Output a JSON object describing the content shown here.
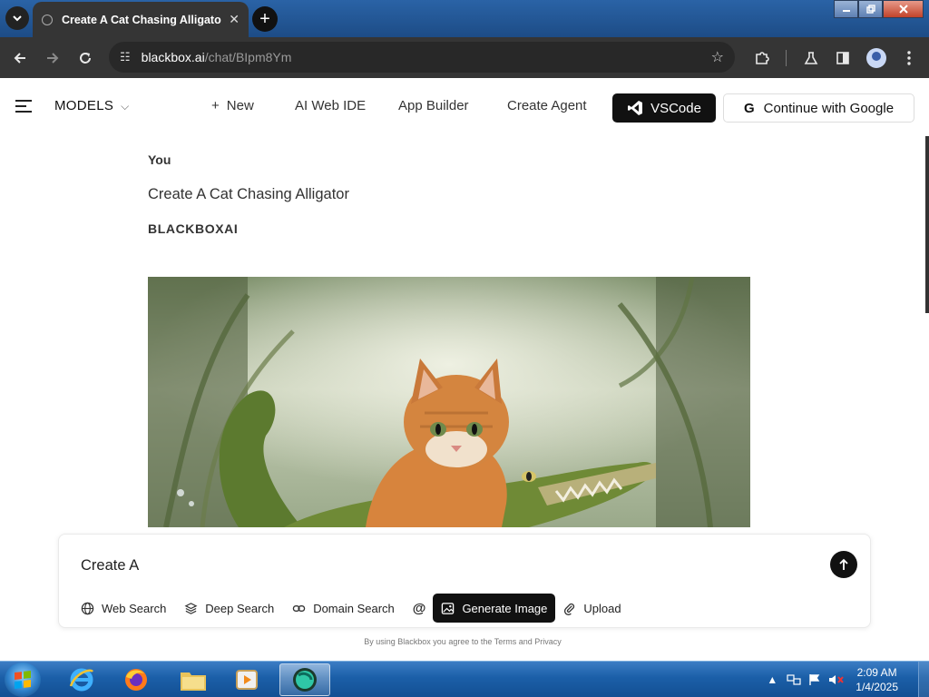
{
  "browser": {
    "tab_title": "Create A Cat Chasing Alligator",
    "tab_close": "✕",
    "new_tab": "+",
    "url_host": "blackbox.ai",
    "url_path": "/chat/BIpm8Ym"
  },
  "header": {
    "models_label": "MODELS",
    "new_label": "New",
    "nav": [
      "AI Web IDE",
      "App Builder",
      "Create Agent"
    ],
    "vscode_label": "VSCode",
    "google_label": "Continue with Google"
  },
  "chat": {
    "user_name": "You",
    "user_prompt": "Create A Cat Chasing Alligator",
    "bot_name": "BLACKBOXAI"
  },
  "input": {
    "value": "Create A",
    "tools": {
      "web_search": "Web Search",
      "deep_search": "Deep Search",
      "domain_search": "Domain Search",
      "mention": "@",
      "generate_image": "Generate Image",
      "upload": "Upload"
    },
    "terms": "By using Blackbox you agree to the Terms and Privacy"
  },
  "taskbar": {
    "time": "2:09 AM",
    "date": "1/4/2025"
  }
}
